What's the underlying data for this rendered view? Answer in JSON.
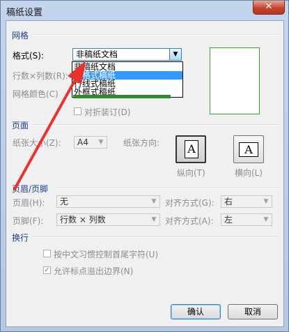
{
  "window": {
    "title": "稿纸设置",
    "close_label": "✕"
  },
  "grid": {
    "section": "网格",
    "format_label": "格式(S):",
    "format_value": "非稿纸文档",
    "format_options": [
      "非稿纸文档",
      "方格式稿纸",
      "行线式稿纸",
      "外框式稿纸"
    ],
    "rows_cols_label": "行数×列数(R):",
    "grid_color_label": "网格颜色(C)",
    "fold_label": "对折装订(D)"
  },
  "page": {
    "section": "页面",
    "size_label": "纸张大小(Z):",
    "size_value": "A4",
    "orientation_label": "纸张方向:",
    "portrait_label": "纵向(T)",
    "landscape_label": "横向(L)",
    "paper_glyph": "A"
  },
  "header_footer": {
    "section": "页眉/页脚",
    "header_label": "页眉(H):",
    "header_value": "无",
    "header_align_label": "对齐方式(G):",
    "header_align_value": "右",
    "footer_label": "页脚(F):",
    "footer_value": "行数 × 列数",
    "footer_align_label": "对齐方式(A):",
    "footer_align_value": "左"
  },
  "wrap": {
    "section": "换行",
    "opt1_label": "按中文习惯控制首尾字符(U)",
    "opt2_label": "允许标点溢出边界(N)"
  },
  "buttons": {
    "ok": "确认",
    "cancel": "取消"
  },
  "colors": {
    "annotation_arrow": "#e8322f",
    "preview_border": "#31a331",
    "selection": "#3399ff"
  }
}
